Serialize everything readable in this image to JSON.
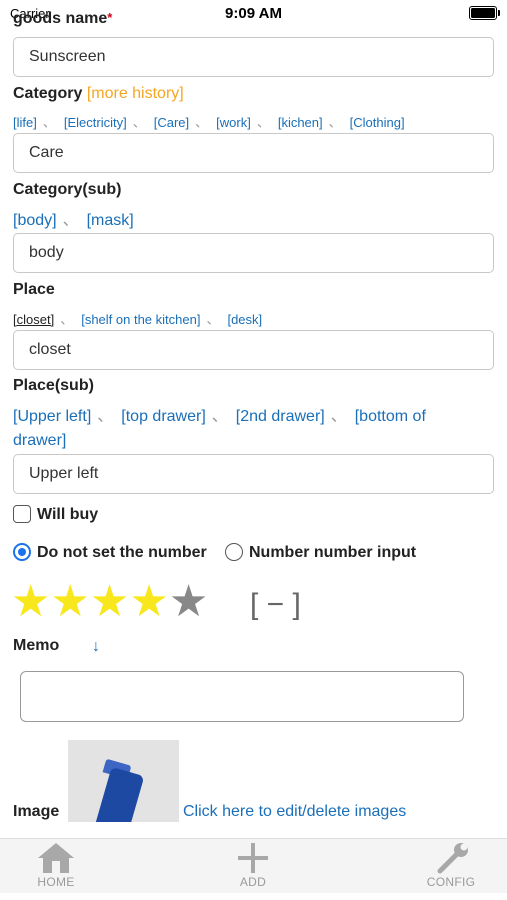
{
  "status": {
    "carrier": "Carrier",
    "time": "9:09 AM"
  },
  "goods": {
    "label": "goods name",
    "required": "*",
    "value": "Sunscreen"
  },
  "category": {
    "label": "Category",
    "history_link": "[more history]",
    "chips": [
      "[life]",
      "[Electricity]",
      "[Care]",
      "[work]",
      "[kichen]",
      "[Clothing]"
    ],
    "value": "Care"
  },
  "category_sub": {
    "label": "Category(sub)",
    "chips": [
      "[body]",
      "[mask]"
    ],
    "value": "body"
  },
  "place": {
    "label": "Place",
    "chips": [
      "[closet]",
      "[shelf on the kitchen]",
      "[desk]"
    ],
    "value": "closet"
  },
  "place_sub": {
    "label": "Place(sub)",
    "chips": [
      "[Upper left]",
      "[top drawer]",
      "[2nd drawer]",
      "[bottom of drawer]"
    ],
    "value": "Upper left"
  },
  "will_buy": {
    "label": "Will buy",
    "checked": false
  },
  "number_mode": {
    "option1": "Do not set the number",
    "option2": "Number number input",
    "selected": "option1"
  },
  "rating": {
    "value": 4,
    "max": 5,
    "clear_label": "[ − ]"
  },
  "memo": {
    "label": "Memo",
    "arrow": "↓",
    "value": ""
  },
  "image": {
    "label": "Image",
    "edit_link": "Click here to edit/delete images"
  },
  "tabbar": {
    "home": "HOME",
    "add": "ADD",
    "config": "CONFIG"
  },
  "separator": "、",
  "colors": {
    "link": "#1a6fb8",
    "orange": "#f5a623",
    "star_on": "#f8e71c",
    "star_off": "#888888",
    "radio": "#1a73e8"
  }
}
